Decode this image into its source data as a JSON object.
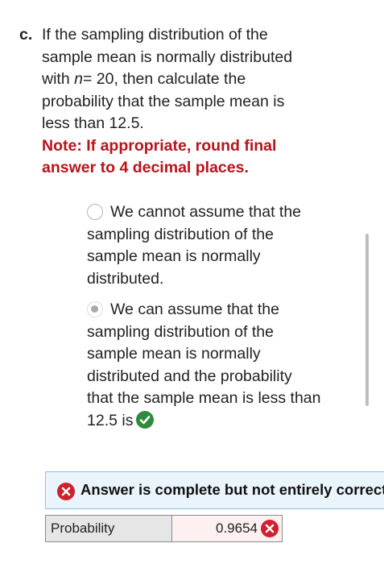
{
  "question": {
    "label": "c.",
    "text_lines": [
      "If the sampling distribution of the",
      "sample mean is normally distributed",
      "with",
      "n",
      "= 20, then calculate the",
      "probability that the sample mean is",
      "less than 12.5."
    ],
    "note_lines": [
      "Note: If appropriate, round final",
      "answer to 4 decimal places."
    ]
  },
  "options": [
    {
      "selected": false,
      "lines": [
        "We cannot assume that the",
        "sampling distribution of the",
        "sample mean is normally",
        "distributed."
      ]
    },
    {
      "selected": true,
      "lines": [
        "We can assume that the",
        "sampling distribution of the",
        "sample mean is normally",
        "distributed and the probability",
        "that the sample mean is less than",
        "12.5 is"
      ],
      "result_icon": "check-circle-icon"
    }
  ],
  "feedback": {
    "text": "Answer is complete but not entirely correct.",
    "icon": "error-x-icon"
  },
  "result_table": {
    "label": "Probability",
    "value": "0.9654",
    "status_icon": "incorrect-x-icon"
  },
  "colors": {
    "note_red": "#b8141a",
    "check_green": "#2e8b3c",
    "error_red": "#d0202e",
    "feedback_bg": "#eaf4fc",
    "feedback_border": "#8fc3e8",
    "value_cell_bg": "#fdf0f1",
    "label_cell_bg": "#e6e6e6"
  }
}
